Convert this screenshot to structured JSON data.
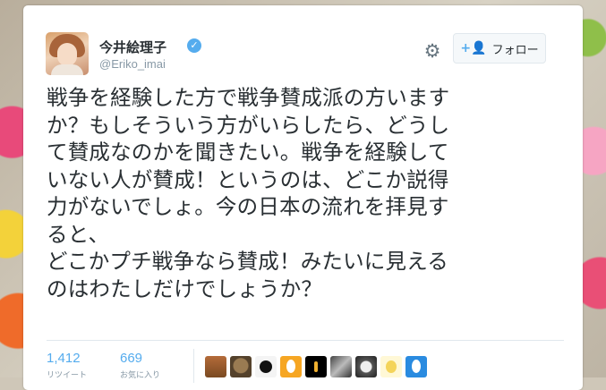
{
  "profile": {
    "name": "今井絵理子",
    "handle": "@Eriko_imai",
    "verified": true
  },
  "actions": {
    "follow_label": "フォロー",
    "follow_icon": "add-user-icon",
    "settings_icon": "gear-icon"
  },
  "tweet": {
    "lines": [
      "戦争を経験した方で戦争賛成派の方いますか？もしそういう方がいらしたら、どうして賛成なのかを聞きたい。戦争を経験していない人が賛成！というのは、どこか説得力がないでしょ。今の日本の流れを拝見すると、",
      "どこかプチ戦争なら賛成！みたいに見えるのはわたしだけでしょうか？"
    ],
    "display_lines": [
      "戦争を経験した方で戦争賛成派の方います",
      "か？もしそういう方がいらしたら、どうし",
      "て賛成なのかを聞きたい。戦争を経験して",
      "いない人が賛成！というのは、どこか説得",
      "力がないでしょ。今の日本の流れを拝見す",
      "ると、",
      "どこかプチ戦争なら賛成！みたいに見える",
      "のはわたしだけでしょうか？"
    ]
  },
  "stats": {
    "retweets": {
      "count": "1,412",
      "label": "リツイート"
    },
    "likes": {
      "count": "669",
      "label": "お気に入り"
    }
  },
  "likers_count_shown": 9,
  "colors": {
    "accent": "#55acee",
    "text": "#292f33",
    "muted": "#8899a6"
  }
}
